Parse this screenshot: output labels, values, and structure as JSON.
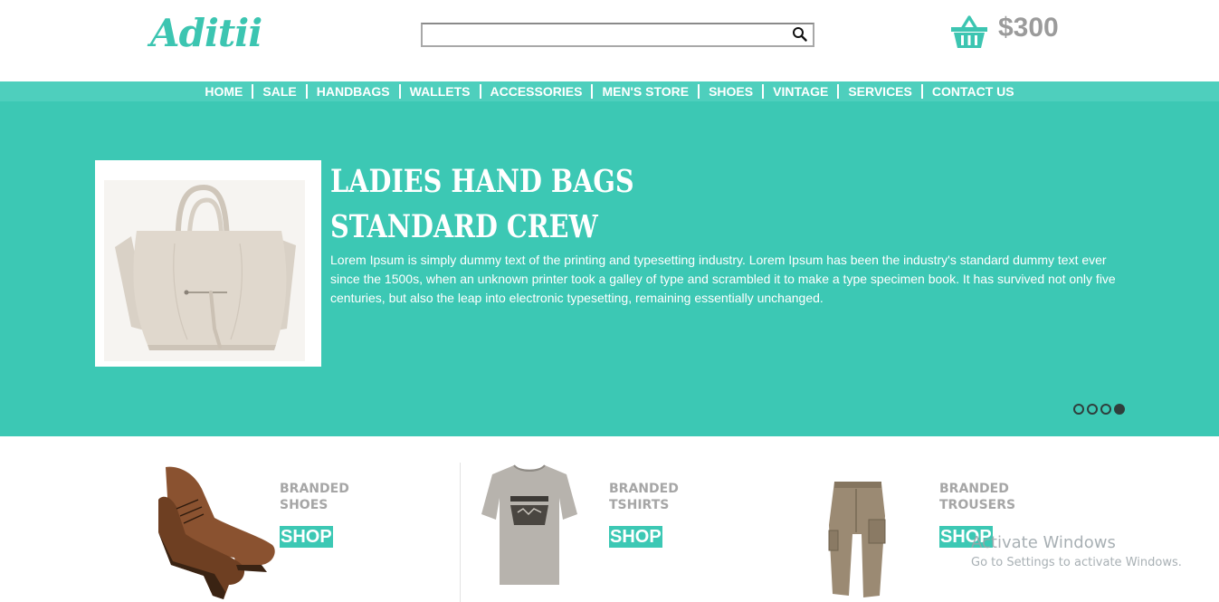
{
  "header": {
    "logo": "Aditii",
    "search": {
      "value": "",
      "placeholder": ""
    },
    "cart_amount": "$300"
  },
  "nav": {
    "items": [
      "HOME",
      "SALE",
      "HANDBAGS",
      "WALLETS",
      "ACCESSORIES",
      "MEN'S STORE",
      "SHOES",
      "VINTAGE",
      "SERVICES",
      "CONTACT US"
    ]
  },
  "hero": {
    "title_line1": "LADIES HAND BAGS",
    "title_line2": "STANDARD CREW",
    "text": "Lorem Ipsum is simply dummy text of the printing and typesetting industry. Lorem Ipsum has been the industry's standard dummy text ever since the 1500s, when an unknown printer took a galley of type and scrambled it to make a type specimen book. It has survived not only five centuries, but also the leap into electronic typesetting, remaining essentially unchanged.",
    "slides_count": 4,
    "active_slide": 4
  },
  "products": [
    {
      "label": "BRANDED\nSHOES",
      "button": "SHOP"
    },
    {
      "label": "BRANDED\nTSHIRTS",
      "button": "SHOP"
    },
    {
      "label": "BRANDED\nTROUSERS",
      "button": "SHOP"
    }
  ],
  "watermark": {
    "line1": "Activate Windows",
    "line2": "Go to Settings to activate Windows."
  },
  "colors": {
    "accent": "#3cc8b4",
    "nav": "#4ecfbd",
    "gray_text": "#a6a6a6"
  }
}
